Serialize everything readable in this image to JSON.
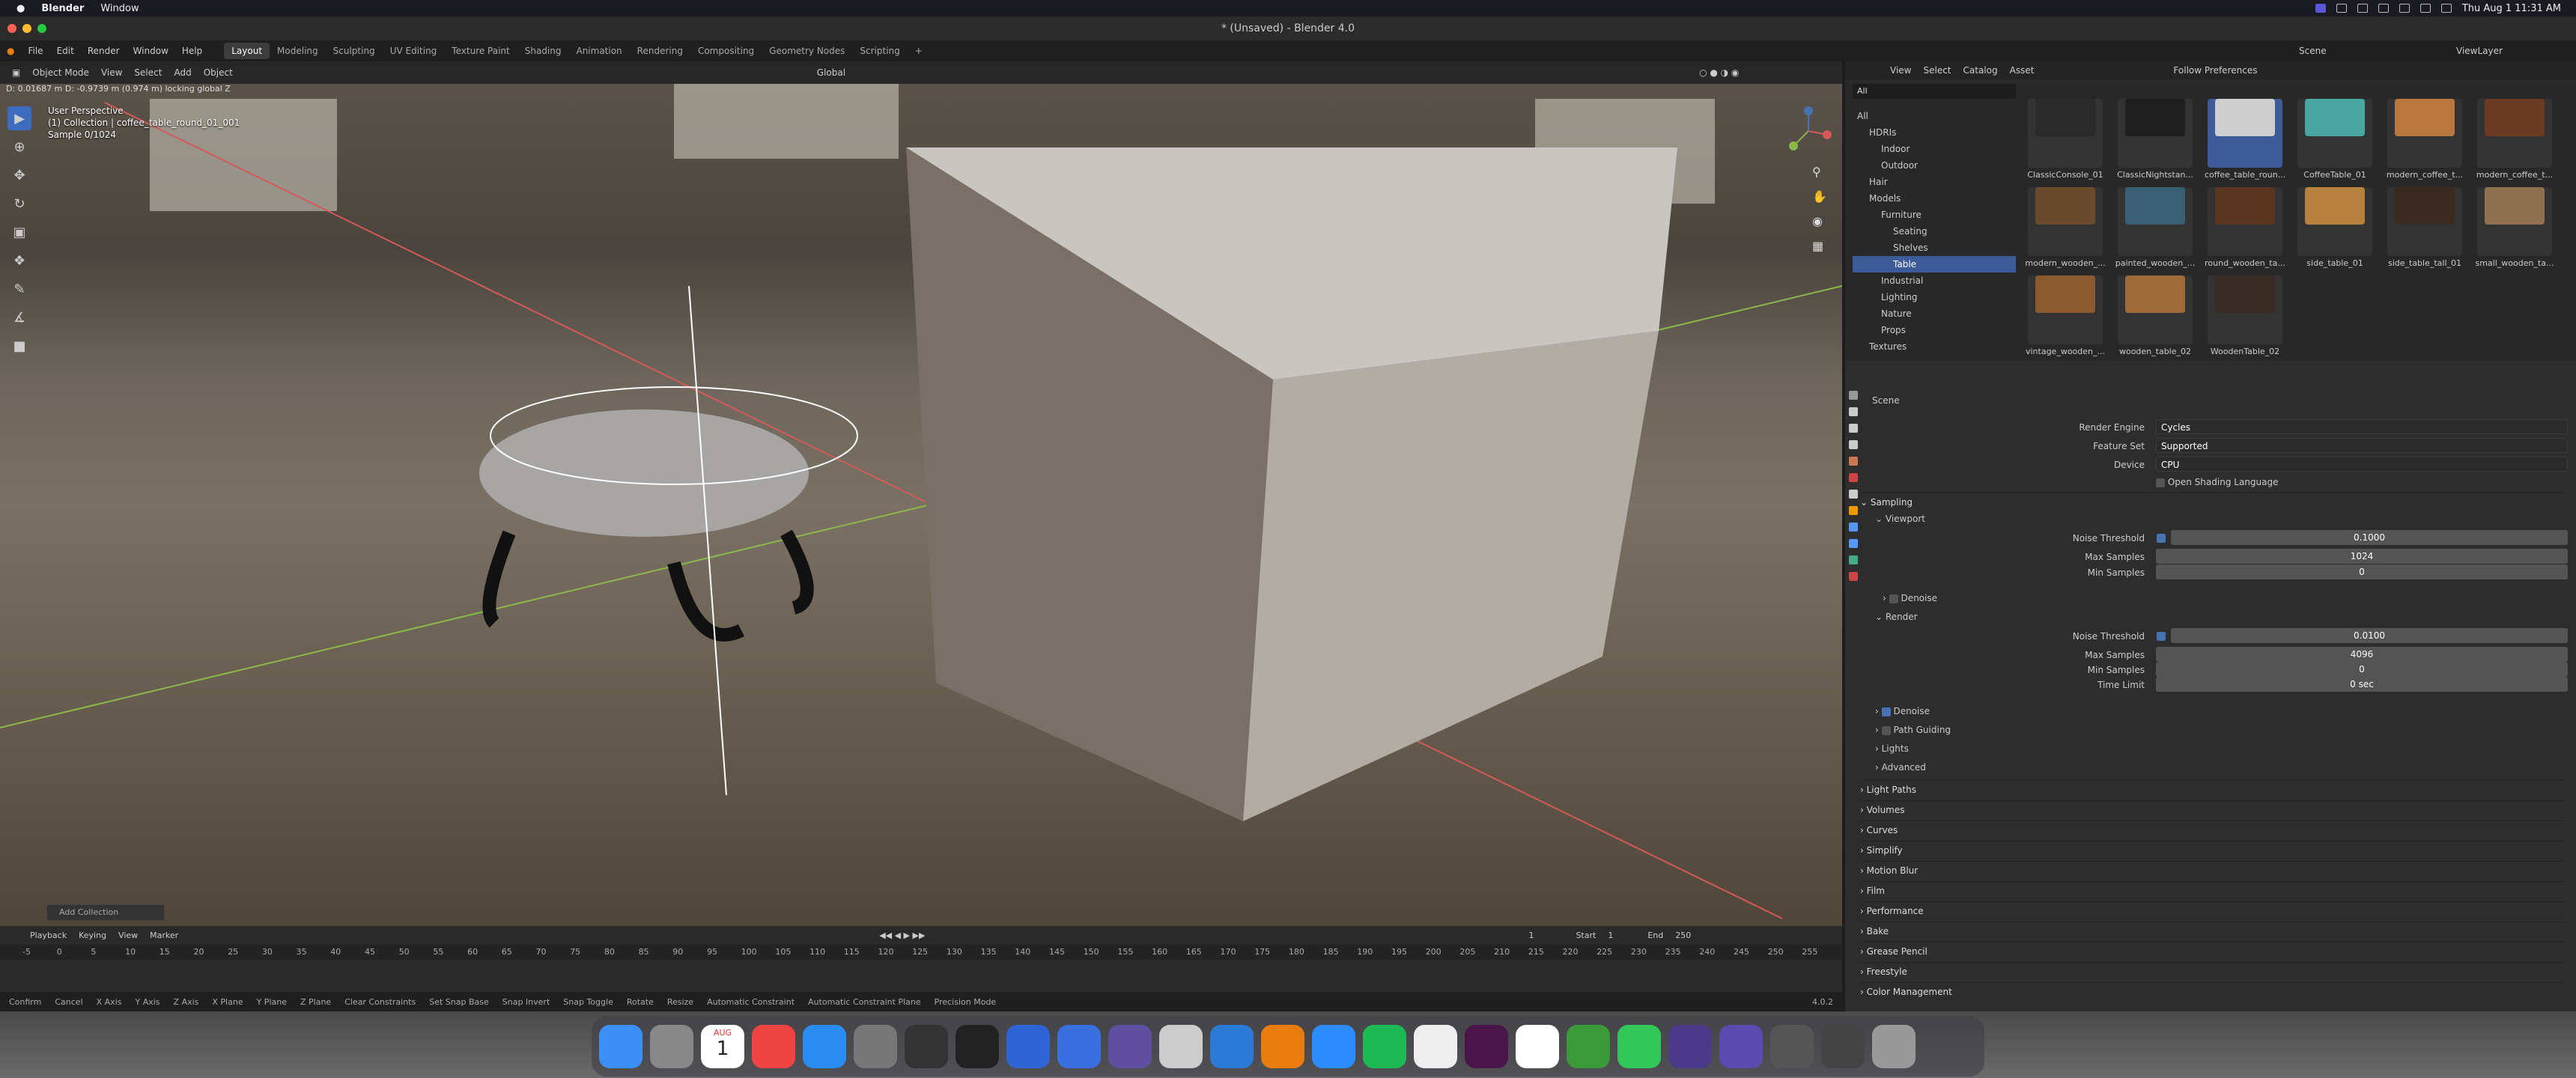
{
  "macos": {
    "apple": "",
    "app_name": "Blender",
    "menu": [
      "Window"
    ],
    "clock": "Thu Aug 1  11:31 AM"
  },
  "window": {
    "title": "* (Unsaved) - Blender 4.0"
  },
  "topbar": {
    "menus": [
      "File",
      "Edit",
      "Render",
      "Window",
      "Help"
    ],
    "workspaces": [
      "Layout",
      "Modeling",
      "Sculpting",
      "UV Editing",
      "Texture Paint",
      "Shading",
      "Animation",
      "Rendering",
      "Compositing",
      "Geometry Nodes",
      "Scripting"
    ],
    "active_workspace": "Layout",
    "scene": "Scene",
    "view_layer": "ViewLayer"
  },
  "viewport_header": {
    "mode": "Object Mode",
    "menus": [
      "View",
      "Select",
      "Add",
      "Object"
    ],
    "transform": "Global"
  },
  "viewport": {
    "measure": "D: 0.01687 m   D: -0.9739 m (0.974 m) locking global Z",
    "perspective": "User Perspective",
    "collection": "(1) Collection | coffee_table_round_01_001",
    "sample": "Sample 0/1024",
    "add_collection": "Add Collection"
  },
  "timeline": {
    "menus": [
      "Playback",
      "Keying",
      "View",
      "Marker"
    ],
    "current_frame": "1",
    "start_label": "Start",
    "start": "1",
    "end_label": "End",
    "end": "250",
    "ticks": [
      "-5",
      "0",
      "5",
      "10",
      "15",
      "20",
      "25",
      "30",
      "35",
      "40",
      "45",
      "50",
      "55",
      "60",
      "65",
      "70",
      "75",
      "80",
      "85",
      "90",
      "95",
      "100",
      "105",
      "110",
      "115",
      "120",
      "125",
      "130",
      "135",
      "140",
      "145",
      "150",
      "155",
      "160",
      "165",
      "170",
      "175",
      "180",
      "185",
      "190",
      "195",
      "200",
      "205",
      "210",
      "215",
      "220",
      "225",
      "230",
      "235",
      "240",
      "245",
      "250",
      "255"
    ]
  },
  "statusbar": {
    "items": [
      "Confirm",
      "Cancel",
      "X Axis",
      "Y Axis",
      "Z Axis",
      "X Plane",
      "Y Plane",
      "Z Plane",
      "Clear Constraints",
      "Set Snap Base",
      "Snap Invert",
      "Snap Toggle",
      "Rotate",
      "Resize",
      "Automatic Constraint",
      "Automatic Constraint Plane",
      "Precision Mode"
    ],
    "version": "4.0.2"
  },
  "asset_browser": {
    "menus": [
      "View",
      "Select",
      "Catalog",
      "Asset"
    ],
    "library": "Follow Preferences",
    "filter": "All",
    "tree": [
      {
        "label": "All",
        "indent": 0
      },
      {
        "label": "HDRIs",
        "indent": 1
      },
      {
        "label": "Indoor",
        "indent": 2
      },
      {
        "label": "Outdoor",
        "indent": 2
      },
      {
        "label": "Hair",
        "indent": 1
      },
      {
        "label": "Models",
        "indent": 1
      },
      {
        "label": "Furniture",
        "indent": 2
      },
      {
        "label": "Seating",
        "indent": 3
      },
      {
        "label": "Shelves",
        "indent": 3
      },
      {
        "label": "Table",
        "indent": 3
      },
      {
        "label": "Industrial",
        "indent": 2
      },
      {
        "label": "Lighting",
        "indent": 2
      },
      {
        "label": "Nature",
        "indent": 2
      },
      {
        "label": "Props",
        "indent": 2
      },
      {
        "label": "Textures",
        "indent": 1
      }
    ],
    "selected_tree": "Table",
    "assets": [
      {
        "name": "ClassicConsole_01",
        "color": "#2a2a2a"
      },
      {
        "name": "ClassicNightstan...",
        "color": "#1e1e1e"
      },
      {
        "name": "coffee_table_roun...",
        "color": "#cfcfcf"
      },
      {
        "name": "CoffeeTable_01",
        "color": "#4aa6a0"
      },
      {
        "name": "modern_coffee_t...",
        "color": "#b8773c"
      },
      {
        "name": "modern_coffee_t...",
        "color": "#6a3a22"
      },
      {
        "name": "modern_wooden_...",
        "color": "#6a4a2c"
      },
      {
        "name": "painted_wooden_...",
        "color": "#3a5e74"
      },
      {
        "name": "round_wooden_ta...",
        "color": "#5a3520"
      },
      {
        "name": "side_table_01",
        "color": "#b8803e"
      },
      {
        "name": "side_table_tall_01",
        "color": "#3a2a20"
      },
      {
        "name": "small_wooden_ta...",
        "color": "#8e7050"
      },
      {
        "name": "vintage_wooden_...",
        "color": "#8a5a2e"
      },
      {
        "name": "wooden_table_02",
        "color": "#9e6a3a"
      },
      {
        "name": "WoodenTable_02",
        "color": "#3a2c24"
      }
    ],
    "selected_asset": "coffee_table_roun..."
  },
  "properties": {
    "context": "Scene",
    "render_engine_label": "Render Engine",
    "render_engine": "Cycles",
    "feature_set_label": "Feature Set",
    "feature_set": "Supported",
    "device_label": "Device",
    "device": "CPU",
    "osl": "Open Shading Language",
    "sampling": "Sampling",
    "viewport_panel": "Viewport",
    "noise_threshold_label": "Noise Threshold",
    "viewport_noise": "0.1000",
    "max_samples_label": "Max Samples",
    "viewport_max": "1024",
    "min_samples_label": "Min Samples",
    "viewport_min": "0",
    "denoise": "Denoise",
    "render_panel": "Render",
    "render_noise": "0.0100",
    "render_max": "4096",
    "render_min": "0",
    "time_limit_label": "Time Limit",
    "time_limit": "0 sec",
    "sub_panels": [
      "Denoise",
      "Path Guiding",
      "Lights",
      "Advanced"
    ],
    "sections": [
      "Light Paths",
      "Volumes",
      "Curves",
      "Simplify",
      "Motion Blur",
      "Film",
      "Performance",
      "Bake",
      "Grease Pencil",
      "Freestyle",
      "Color Management"
    ]
  },
  "dock": {
    "apps": [
      {
        "name": "Finder",
        "color": "#3b8ff5"
      },
      {
        "name": "Launchpad",
        "color": "#888"
      },
      {
        "name": "Calendar",
        "color": "#fff"
      },
      {
        "name": "Chrome",
        "color": "#e44"
      },
      {
        "name": "App Store",
        "color": "#2a8cf0"
      },
      {
        "name": "System Settings",
        "color": "#777"
      },
      {
        "name": "Final Cut",
        "color": "#333"
      },
      {
        "name": "Figma",
        "color": "#222"
      },
      {
        "name": "Docs",
        "color": "#2f64d6"
      },
      {
        "name": "Docs 2",
        "color": "#3a6fe0"
      },
      {
        "name": "Affinity",
        "color": "#5f4fa0"
      },
      {
        "name": "DVD",
        "color": "#ccc"
      },
      {
        "name": "VS Code",
        "color": "#2b7ad6"
      },
      {
        "name": "Blender",
        "color": "#e87d0d"
      },
      {
        "name": "Zoom",
        "color": "#2d8cff"
      },
      {
        "name": "Spotify",
        "color": "#1db954"
      },
      {
        "name": "Safari",
        "color": "#eee"
      },
      {
        "name": "Slack",
        "color": "#4a154b"
      },
      {
        "name": "Notion",
        "color": "#fff"
      },
      {
        "name": "Gradle",
        "color": "#3a9a3a"
      },
      {
        "name": "Messages",
        "color": "#33c759"
      },
      {
        "name": "GitKraken",
        "color": "#4b3a8a"
      },
      {
        "name": "Graphite",
        "color": "#5b4ab0"
      },
      {
        "name": "Stage",
        "color": "#555"
      },
      {
        "name": "Tool",
        "color": "#444"
      },
      {
        "name": "Trash",
        "color": "#999"
      }
    ],
    "calendar_month": "AUG",
    "calendar_day": "1"
  },
  "colors": {
    "accent": "#4772b3",
    "selection": "#3d5a99",
    "x_axis": "#d45a5a",
    "y_axis": "#8cb84a"
  }
}
